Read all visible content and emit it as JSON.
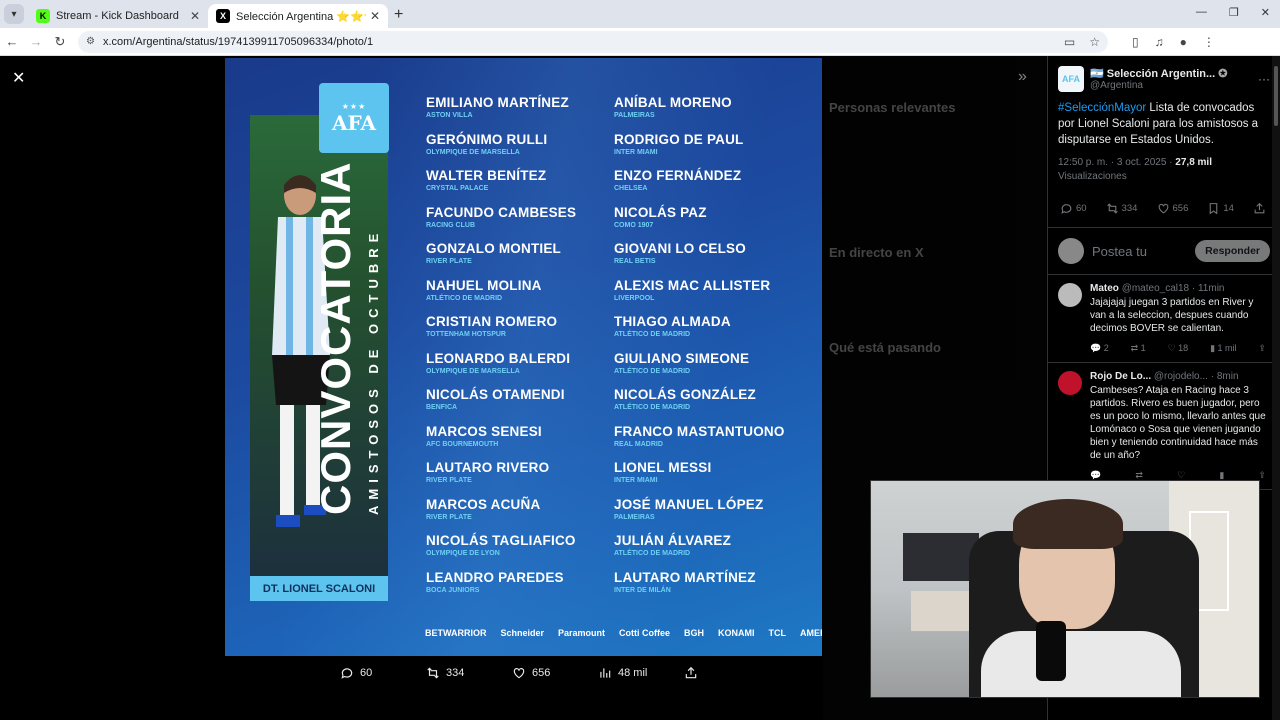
{
  "browser": {
    "tabs": [
      {
        "title": "Stream - Kick Dashboard",
        "favicon": "K",
        "active": false
      },
      {
        "title": "Selección Argentina ⭐⭐⭐",
        "favicon": "AFA",
        "active": true
      }
    ],
    "new_tab_icon": "+",
    "url": "x.com/Argentina/status/1974139911705096334/photo/1"
  },
  "photo": {
    "vertical_title": "CONVOCATORIA",
    "vertical_subtitle": "AMISTOSOS DE OCTUBRE",
    "badge": "AFA",
    "coach": "DT. LIONEL SCALONI",
    "players_left": [
      {
        "name": "EMILIANO MARTÍNEZ",
        "club": "ASTON VILLA"
      },
      {
        "name": "GERÓNIMO RULLI",
        "club": "OLYMPIQUE DE MARSELLA"
      },
      {
        "name": "WALTER BENÍTEZ",
        "club": "CRYSTAL PALACE"
      },
      {
        "name": "FACUNDO CAMBESES",
        "club": "RACING CLUB"
      },
      {
        "name": "GONZALO MONTIEL",
        "club": "RIVER PLATE"
      },
      {
        "name": "NAHUEL MOLINA",
        "club": "ATLÉTICO DE MADRID"
      },
      {
        "name": "CRISTIAN ROMERO",
        "club": "TOTTENHAM HOTSPUR"
      },
      {
        "name": "LEONARDO BALERDI",
        "club": "OLYMPIQUE DE MARSELLA"
      },
      {
        "name": "NICOLÁS OTAMENDI",
        "club": "BENFICA"
      },
      {
        "name": "MARCOS SENESI",
        "club": "AFC BOURNEMOUTH"
      },
      {
        "name": "LAUTARO RIVERO",
        "club": "RIVER PLATE"
      },
      {
        "name": "MARCOS ACUÑA",
        "club": "RIVER PLATE"
      },
      {
        "name": "NICOLÁS TAGLIAFICO",
        "club": "OLYMPIQUE DE LYON"
      },
      {
        "name": "LEANDRO PAREDES",
        "club": "BOCA JUNIORS"
      }
    ],
    "players_right": [
      {
        "name": "ANÍBAL MORENO",
        "club": "PALMEIRAS"
      },
      {
        "name": "RODRIGO DE PAUL",
        "club": "INTER MIAMI"
      },
      {
        "name": "ENZO FERNÁNDEZ",
        "club": "CHELSEA"
      },
      {
        "name": "NICOLÁS PAZ",
        "club": "COMO 1907"
      },
      {
        "name": "GIOVANI LO CELSO",
        "club": "REAL BETIS"
      },
      {
        "name": "ALEXIS MAC ALLISTER",
        "club": "LIVERPOOL"
      },
      {
        "name": "THIAGO ALMADA",
        "club": "ATLÉTICO DE MADRID"
      },
      {
        "name": "GIULIANO SIMEONE",
        "club": "ATLÉTICO DE MADRID"
      },
      {
        "name": "NICOLÁS GONZÁLEZ",
        "club": "ATLÉTICO DE MADRID"
      },
      {
        "name": "FRANCO MASTANTUONO",
        "club": "REAL MADRID"
      },
      {
        "name": "LIONEL MESSI",
        "club": "INTER MIAMI"
      },
      {
        "name": "JOSÉ MANUEL LÓPEZ",
        "club": "PALMEIRAS"
      },
      {
        "name": "JULIÁN ÁLVAREZ",
        "club": "ATLÉTICO DE MADRID"
      },
      {
        "name": "LAUTARO MARTÍNEZ",
        "club": "INTER DE MILÁN"
      }
    ],
    "sponsors": [
      "BETWARRIOR",
      "Schneider",
      "Paramount",
      "Cotti Coffee",
      "BGH",
      "KONAMI",
      "TCL",
      "AMERICAN EXPRESS"
    ]
  },
  "viewer_actions": {
    "replies": "60",
    "reposts": "334",
    "likes": "656",
    "views": "48 mil"
  },
  "background_page": {
    "relevant_people": "Personas relevantes",
    "live": "En directo en X",
    "trending": "Qué está pasando"
  },
  "tweet": {
    "author_name": "Selección Argentin...",
    "author_handle": "@Argentina",
    "hashtag": "#SelecciónMayor",
    "text": " Lista de convocados por Lionel Scaloni para los amistosos a disputarse en Estados Unidos.",
    "time": "12:50 p. m. · 3 oct. 2025 · ",
    "views": "27,8 mil",
    "views_label": "Visualizaciones",
    "replies": "60",
    "reposts": "334",
    "likes": "656",
    "bookmarks": "14"
  },
  "reply_box": {
    "placeholder": "Postea tu",
    "button": "Responder"
  },
  "replies": [
    {
      "name": "Mateo",
      "handle": "@mateo_cal18 · 11min",
      "text": "Jajajajaj juegan 3 partidos en River y van a la seleccion, despues cuando decimos BOVER se calientan.",
      "replies": "2",
      "reposts": "1",
      "likes": "18",
      "views": "1 mil",
      "avatar_color": "#bbbbbb"
    },
    {
      "name": "Rojo De Lo...",
      "handle": "@rojodelo... · 8min",
      "text": "Cambeses? Ataja en Racing hace 3 partidos. Rivero es buen jugador, pero es un poco lo mismo, llevarlo antes que Lomónaco o Sosa que vienen jugando bien y teniendo continuidad hace más de un año?",
      "replies": "",
      "reposts": "",
      "likes": "",
      "views": "",
      "avatar_color": "#c0122a"
    }
  ]
}
